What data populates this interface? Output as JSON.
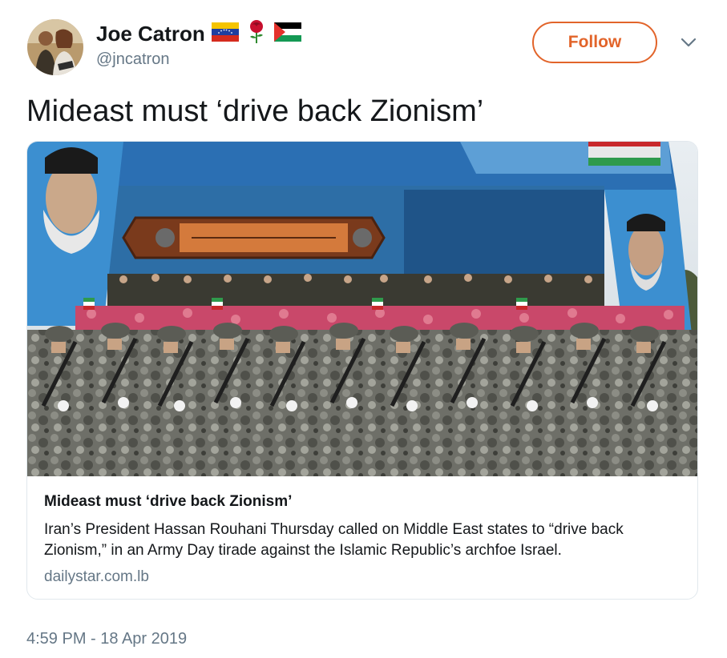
{
  "author": {
    "name": "Joe Catron",
    "handle": "@jncatron",
    "avatar_icon": "two-people-avatar",
    "name_emojis": [
      "venezuela-flag-icon",
      "rose-icon",
      "palestine-flag-icon"
    ]
  },
  "follow_button": {
    "label": "Follow",
    "color": "#e2642a"
  },
  "menu_icon": "chevron-down-icon",
  "tweet": {
    "text": "Mideast must ‘drive back Zionism’",
    "timestamp": "4:59 PM - 18 Apr 2019"
  },
  "link_card": {
    "image_icon": "military-parade-photo",
    "title": "Mideast must ‘drive back Zionism’",
    "description": "Iran’s President Hassan Rouhani Thursday called on Middle East states to “drive back Zionism,” in an Army Day tirade against the Islamic Republic’s archfoe Israel.",
    "domain": "dailystar.com.lb"
  },
  "colors": {
    "text_primary": "#14171a",
    "text_secondary": "#657786",
    "border": "#e1e8ed"
  }
}
